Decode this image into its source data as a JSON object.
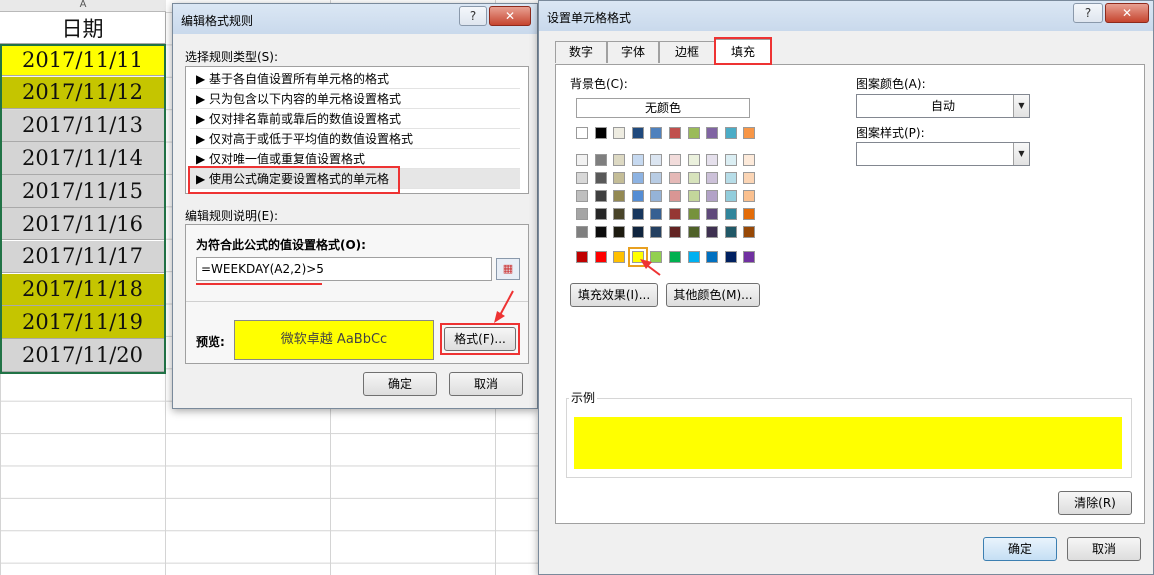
{
  "spreadsheet": {
    "column_letter": "A",
    "header": "日期",
    "rows": [
      {
        "date": "2017/11/11",
        "fill": "#ffff00"
      },
      {
        "date": "2017/11/12",
        "fill": "#c5c500"
      },
      {
        "date": "2017/11/13",
        "fill": "#d4d4d4"
      },
      {
        "date": "2017/11/14",
        "fill": "#d4d4d4"
      },
      {
        "date": "2017/11/15",
        "fill": "#d4d4d4"
      },
      {
        "date": "2017/11/16",
        "fill": "#d4d4d4"
      },
      {
        "date": "2017/11/17",
        "fill": "#d4d4d4"
      },
      {
        "date": "2017/11/18",
        "fill": "#c5c500"
      },
      {
        "date": "2017/11/19",
        "fill": "#c5c500"
      },
      {
        "date": "2017/11/20",
        "fill": "#d4d4d4"
      }
    ]
  },
  "edit_rule_dialog": {
    "title": "编辑格式规则",
    "help_button": "?",
    "close_button": "✕",
    "select_rule_type_label": "选择规则类型(S):",
    "rule_types": [
      "▶ 基于各自值设置所有单元格的格式",
      "▶ 只为包含以下内容的单元格设置格式",
      "▶ 仅对排名靠前或靠后的数值设置格式",
      "▶ 仅对高于或低于平均值的数值设置格式",
      "▶ 仅对唯一值或重复值设置格式",
      "▶ 使用公式确定要设置格式的单元格"
    ],
    "edit_description_label": "编辑规则说明(E):",
    "formula_label": "为符合此公式的值设置格式(O):",
    "formula_value": "=WEEKDAY(A2,2)>5",
    "preview_label": "预览:",
    "preview_text": "微软卓越  AaBbCc",
    "format_button": "格式(F)...",
    "ok_button": "确定",
    "cancel_button": "取消"
  },
  "format_cells_dialog": {
    "title": "设置单元格格式",
    "help_button": "?",
    "close_button": "✕",
    "tabs": [
      "数字",
      "字体",
      "边框",
      "填充"
    ],
    "background_color_label": "背景色(C):",
    "no_color_button": "无颜色",
    "pattern_color_label": "图案颜色(A):",
    "pattern_color_value": "自动",
    "pattern_style_label": "图案样式(P):",
    "pattern_style_value": "",
    "fill_effects_button": "填充效果(I)...",
    "more_colors_button": "其他颜色(M)...",
    "sample_label": "示例",
    "sample_color": "#ffff00",
    "clear_button": "清除(R)",
    "ok_button": "确定",
    "cancel_button": "取消",
    "theme_colors": [
      [
        "#ffffff",
        "#000000",
        "#eeece1",
        "#1f497d",
        "#4f81bd",
        "#c0504d",
        "#9bbb59",
        "#8064a2",
        "#4bacc6",
        "#f79646"
      ],
      [
        "#f2f2f2",
        "#7f7f7f",
        "#ddd9c3",
        "#c6d9f0",
        "#dbe5f1",
        "#f2dcdb",
        "#ebf1dd",
        "#e5e0ec",
        "#dbeef3",
        "#fdeada"
      ],
      [
        "#d8d8d8",
        "#595959",
        "#c4bd97",
        "#8db3e2",
        "#b8cce4",
        "#e5b9b7",
        "#d7e3bc",
        "#ccc1d9",
        "#b7dde8",
        "#fbd5b5"
      ],
      [
        "#bfbfbf",
        "#3f3f3f",
        "#938953",
        "#548dd4",
        "#95b3d7",
        "#d99694",
        "#c3d69b",
        "#b2a2c7",
        "#92cddc",
        "#fac08f"
      ],
      [
        "#a5a5a5",
        "#262626",
        "#494429",
        "#17365d",
        "#366092",
        "#953734",
        "#76923c",
        "#5f497a",
        "#31859b",
        "#e36c09"
      ],
      [
        "#7f7f7f",
        "#0c0c0c",
        "#1d1b10",
        "#0f243e",
        "#244061",
        "#632423",
        "#4f6128",
        "#3f3151",
        "#205867",
        "#974806"
      ]
    ],
    "standard_colors": [
      "#c00000",
      "#ff0000",
      "#ffc000",
      "#ffff00",
      "#92d050",
      "#00b050",
      "#00b0f0",
      "#0070c0",
      "#002060",
      "#7030a0"
    ],
    "selected_standard_color": "#ffff00"
  }
}
